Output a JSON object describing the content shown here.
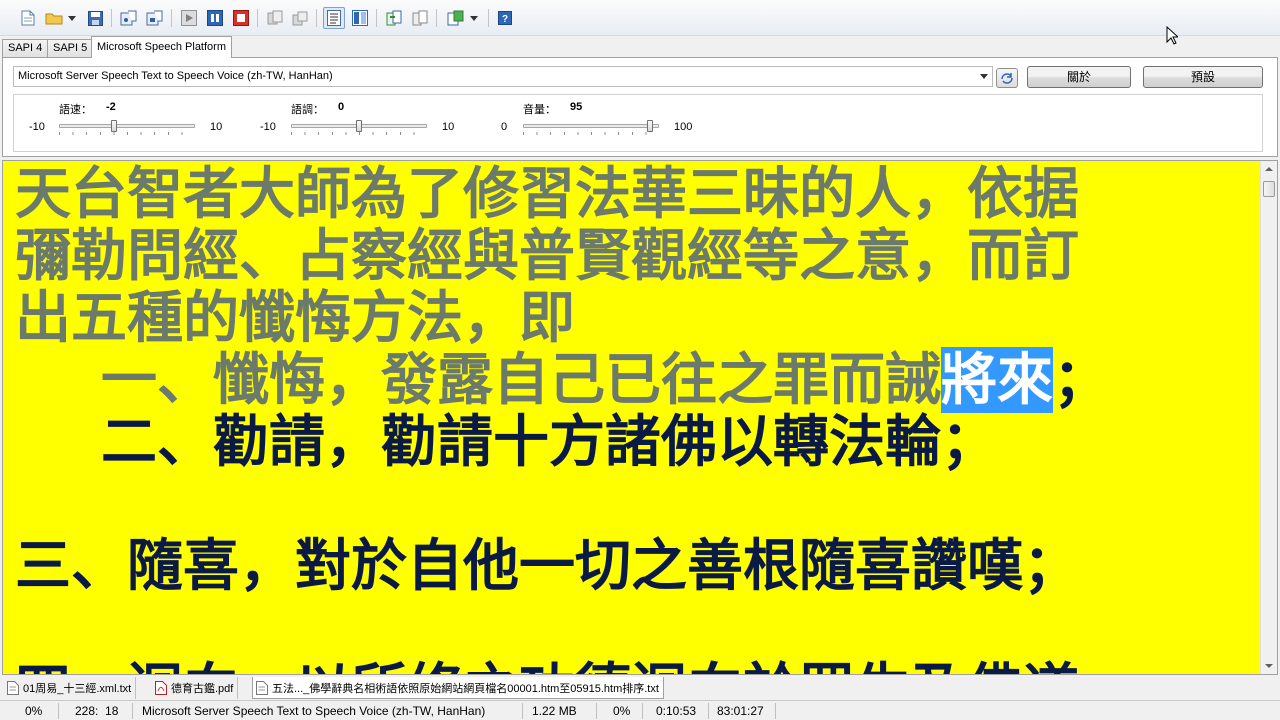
{
  "toolbar": {
    "icons": [
      "new-file-icon",
      "open-folder-icon",
      "dropdown-arrow-icon",
      "save-icon",
      "read-aloud-icon",
      "read-aloud-alt-icon",
      "play-icon",
      "pause-icon",
      "stop-icon",
      "record-icon",
      "record-alt-icon",
      "text-view-icon",
      "split-view-icon",
      "convert-icon",
      "convert-alt-icon",
      "export-icon",
      "help-icon"
    ]
  },
  "tabs": [
    "SAPI 4",
    "SAPI 5",
    "Microsoft Speech Platform"
  ],
  "voice": {
    "selected": "Microsoft Server Speech Text to Speech Voice (zh-TW, HanHan)",
    "about_button": "關於",
    "default_button": "預設"
  },
  "sliders": [
    {
      "label": "語速：",
      "value": "-2",
      "min": "-10",
      "max": "10",
      "level": 0.4
    },
    {
      "label": "語調：",
      "value": "0",
      "min": "-10",
      "max": "10",
      "level": 0.5
    },
    {
      "label": "音量：",
      "value": "95",
      "min": "0",
      "max": "100",
      "level": 0.95
    }
  ],
  "document": {
    "line1": "天台智者大師為了修習法華三昧的人，依据",
    "line2": "彌勒問經、占察經與普賢觀經等之意，而訂",
    "line3": "出五種的懺悔方法，即",
    "line4_read": "一、懺悔，發露自己已往之罪而誡",
    "line4_highlight": "將來",
    "line4_rest": "；",
    "line5": "二、勸請，勸請十方諸佛以轉法輪；",
    "line6": "三、隨喜，對於自他一切之善根隨喜讚嘆；",
    "line7": "四、迴向，以所修之功德迴向於眾生及佛道"
  },
  "file_tabs": [
    {
      "name": "01周易_十三經.xml.txt",
      "icon": "text-file-icon"
    },
    {
      "name": "德育古鑑.pdf",
      "icon": "pdf-file-icon"
    },
    {
      "name": "五法..._佛學辭典名相術語依照原始網站網頁檔名00001.htm至05915.htm排序.txt",
      "icon": "text-file-icon"
    }
  ],
  "status": {
    "percent": "0%",
    "position": "228:  18",
    "voice": "Microsoft Server Speech Text to Speech Voice (zh-TW, HanHan)",
    "size": "1.22 MB",
    "progress": "0%",
    "elapsed": "0:10:53",
    "total": "83:01:27"
  },
  "colors": {
    "background": "#ffff00",
    "read_text": "#6b7a6b",
    "unread_text": "#0a1a44",
    "highlight": "#3399ff"
  }
}
